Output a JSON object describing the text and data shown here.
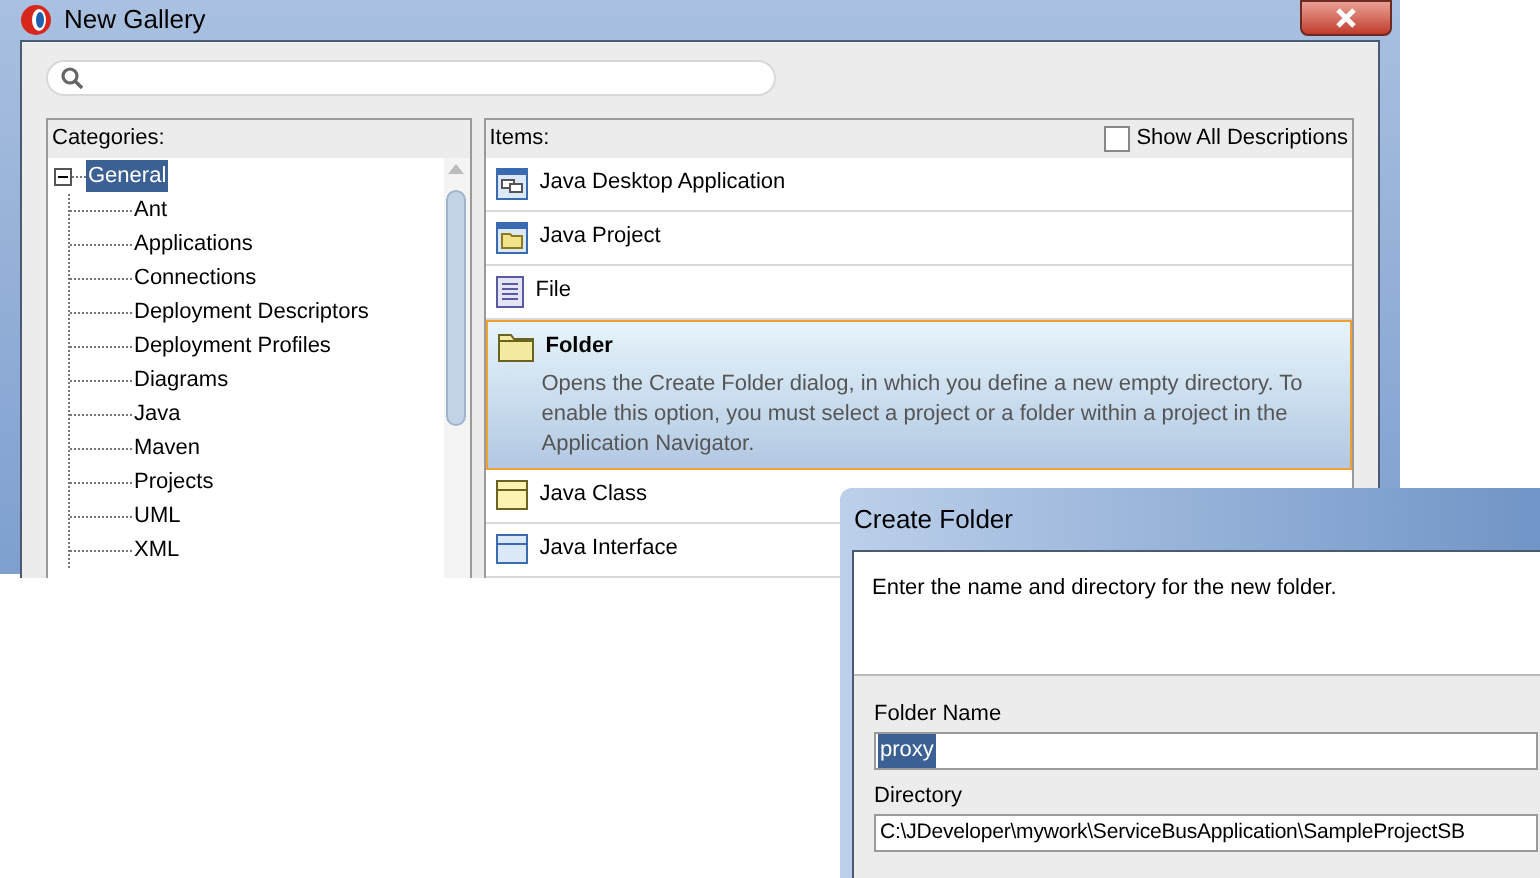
{
  "window": {
    "title": "New Gallery"
  },
  "categories": {
    "label": "Categories:",
    "tree": [
      {
        "label": "General",
        "selected": true,
        "expanded": true,
        "children": [
          {
            "label": "Ant",
            "selected": false
          },
          {
            "label": "Applications",
            "selected": false
          },
          {
            "label": "Connections",
            "selected": false
          },
          {
            "label": "Deployment Descriptors",
            "selected": false
          },
          {
            "label": "Deployment Profiles",
            "selected": false
          },
          {
            "label": "Diagrams",
            "selected": false
          },
          {
            "label": "Java",
            "selected": false
          },
          {
            "label": "Maven",
            "selected": false
          },
          {
            "label": "Projects",
            "selected": false
          },
          {
            "label": "UML",
            "selected": false
          },
          {
            "label": "XML",
            "selected": false
          }
        ]
      }
    ]
  },
  "items": {
    "label": "Items:",
    "show_all_descriptions": {
      "label": "Show All Descriptions",
      "checked": false
    },
    "rows": [
      {
        "kind": "desktop-app",
        "label": "Java Desktop Application",
        "selected": false
      },
      {
        "kind": "project",
        "label": "Java Project",
        "selected": false
      },
      {
        "kind": "file",
        "label": "File",
        "selected": false
      },
      {
        "kind": "folder",
        "label": "Folder",
        "selected": true,
        "description": "Opens the Create Folder dialog, in which you define a new empty directory. To enable this option, you must select a project or a folder within a project in the Application Navigator."
      },
      {
        "kind": "class",
        "label": "Java Class",
        "selected": false
      },
      {
        "kind": "interface",
        "label": "Java Interface",
        "selected": false
      }
    ]
  },
  "dialog": {
    "title": "Create Folder",
    "instructions": "Enter the name and directory for the new folder.",
    "fields": [
      {
        "label": "Folder Name",
        "value": "proxy",
        "selected": true
      },
      {
        "label": "Directory",
        "value": "C:\\JDeveloper\\mywork\\ServiceBusApplication\\SampleProjectSB",
        "selected": false
      }
    ]
  }
}
